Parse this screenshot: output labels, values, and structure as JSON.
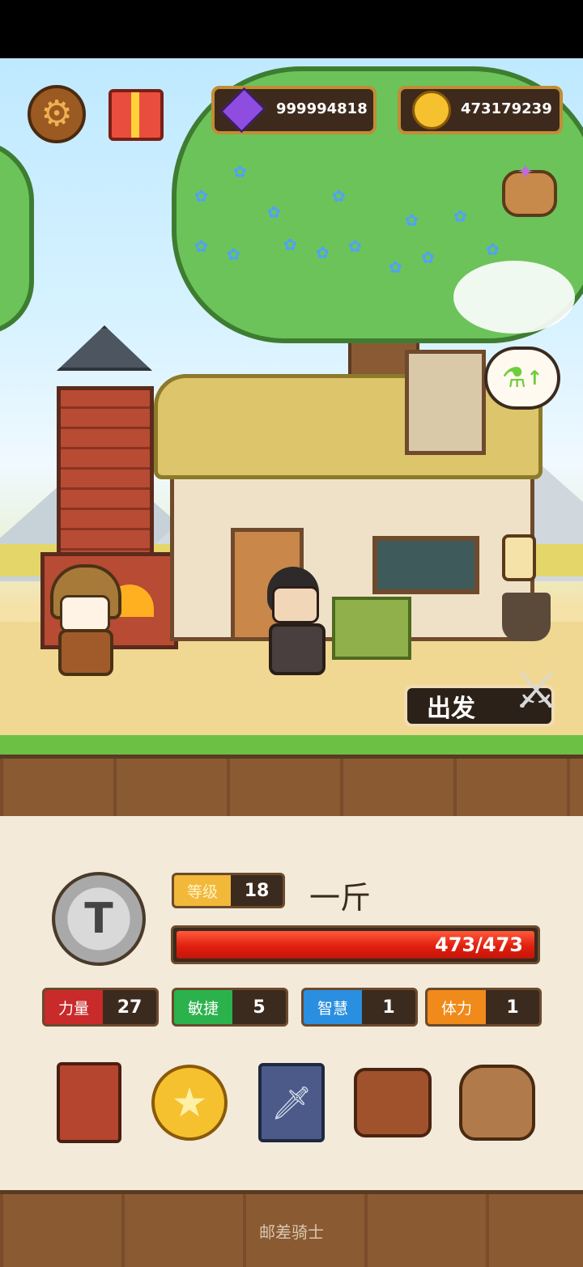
{
  "currencies": {
    "gems": "999994818",
    "coins": "473179239"
  },
  "scene": {
    "depart_label": "出发"
  },
  "hero": {
    "level_label": "等级",
    "level": "18",
    "name": "一斤",
    "hp": "473/473",
    "hp_fraction": 1.0,
    "emblem_letter": "T"
  },
  "stats": [
    {
      "label": "力量",
      "value": "27",
      "color": "#c92a2a"
    },
    {
      "label": "敏捷",
      "value": "5",
      "color": "#2bb24c"
    },
    {
      "label": "智慧",
      "value": "1",
      "color": "#2a8fe0"
    },
    {
      "label": "体力",
      "value": "1",
      "color": "#f08a1a"
    }
  ],
  "menu_icons": [
    "book-icon",
    "star-coin-icon",
    "cards-icon",
    "backpack-icon",
    "loot-bag-icon"
  ],
  "footer": {
    "title": "邮差骑士"
  },
  "colors": {
    "gold_accent": "#f2b83a",
    "hp_red": "#e02010",
    "panel_bg": "#f3ead9"
  }
}
